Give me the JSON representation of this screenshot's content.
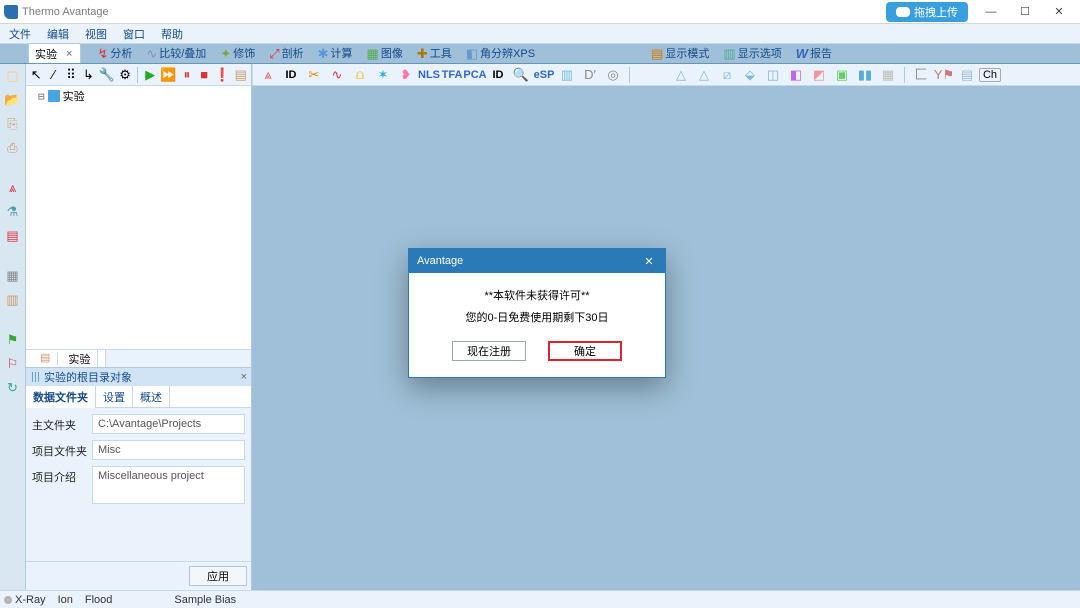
{
  "titlebar": {
    "app_name": "Thermo Avantage",
    "cloud_btn": "拖拽上传"
  },
  "menus": [
    "文件",
    "编辑",
    "视图",
    "窗口",
    "帮助"
  ],
  "left_tab": "实验",
  "analysis_tabs": [
    {
      "icon": "chart-icon",
      "label": "分析"
    },
    {
      "icon": "overlay-icon",
      "label": "比较/叠加"
    },
    {
      "icon": "decorate-icon",
      "label": "修饰"
    },
    {
      "icon": "profile-icon",
      "label": "剖析"
    },
    {
      "icon": "calc-icon",
      "label": "计算"
    },
    {
      "icon": "image-icon",
      "label": "图像"
    },
    {
      "icon": "tool-icon",
      "label": "工具"
    },
    {
      "icon": "ar-icon",
      "label": "角分辨XPS"
    }
  ],
  "right_tabs": [
    {
      "icon": "display-icon",
      "label": "显示模式"
    },
    {
      "icon": "opts-icon",
      "label": "显示选项"
    },
    {
      "icon": "report-icon",
      "label": "报告"
    }
  ],
  "tree": {
    "root_label": "实验"
  },
  "mini_tab": "实验",
  "props": {
    "header": "实验的根目录对象",
    "tabs": [
      "数据文件夹",
      "设置",
      "概述"
    ],
    "rows": {
      "main_folder_label": "主文件夹",
      "main_folder_value": "C:\\Avantage\\Projects",
      "project_folder_label": "项目文件夹",
      "project_folder_value": "Misc",
      "project_desc_label": "项目介绍",
      "project_desc_value": "Miscellaneous project"
    },
    "apply": "应用"
  },
  "dialog": {
    "title": "Avantage",
    "line1": "**本软件未获得许可**",
    "line2": "您的0-日免费使用期剩下30日",
    "register": "现在注册",
    "ok": "确定"
  },
  "status": {
    "xray": "X-Ray",
    "ion": "Ion",
    "flood": "Flood",
    "sample_bias": "Sample Bias"
  },
  "tooltext": {
    "nls": "NLS",
    "tfa": "TFA",
    "pca": "PCA",
    "id": "ID",
    "esp": "eSP",
    "ch": "Ch"
  }
}
